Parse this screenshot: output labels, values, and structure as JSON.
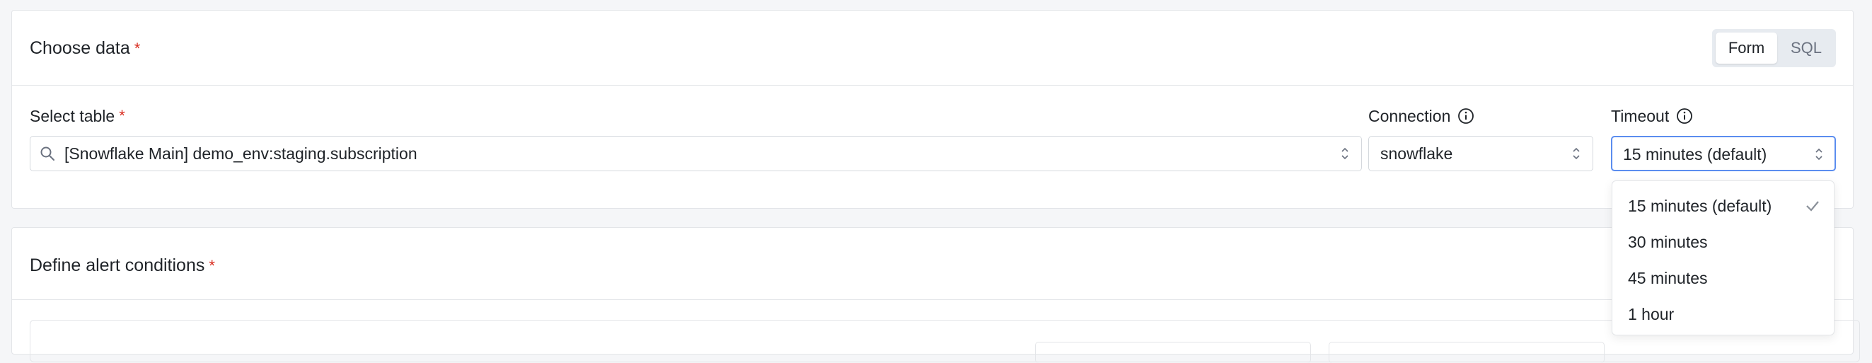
{
  "choose_data": {
    "title": "Choose data",
    "required_mark": "*",
    "mode_toggle": {
      "form_label": "Form",
      "sql_label": "SQL",
      "active": "Form"
    },
    "select_table": {
      "label": "Select table",
      "required_mark": "*",
      "value": "[Snowflake Main] demo_env:staging.subscription"
    },
    "connection": {
      "label": "Connection",
      "value": "snowflake"
    },
    "timeout": {
      "label": "Timeout",
      "value": "15 minutes (default)",
      "options": [
        "15 minutes (default)",
        "30 minutes",
        "45 minutes",
        "1 hour"
      ],
      "selected_index": 0
    }
  },
  "define_alert": {
    "title": "Define alert conditions",
    "required_mark": "*"
  },
  "colors": {
    "required": "#d92d20",
    "focus_border": "#5b8def",
    "toggle_bg": "#e7ebf0"
  },
  "icons": [
    "search-icon",
    "info-icon",
    "chevron-up-down-icon",
    "check-icon"
  ]
}
